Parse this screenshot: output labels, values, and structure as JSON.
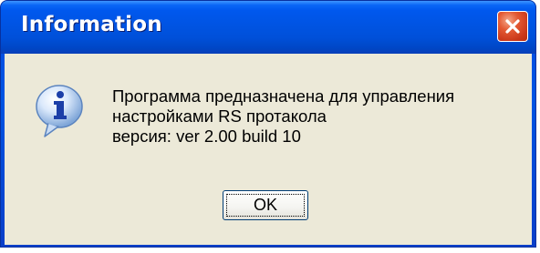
{
  "window": {
    "title": "Information",
    "close_icon": "close-icon"
  },
  "message": {
    "icon": "information-icon",
    "lines": [
      "Программа предназначена для управления",
      "настройками RS протакола",
      "версия: ver 2.00 build 10"
    ]
  },
  "buttons": {
    "ok_label": "OK"
  },
  "colors": {
    "titlebar": "#0054e3",
    "close_button": "#d9481f",
    "client_background": "#ece9d8",
    "button_border": "#003c74"
  }
}
